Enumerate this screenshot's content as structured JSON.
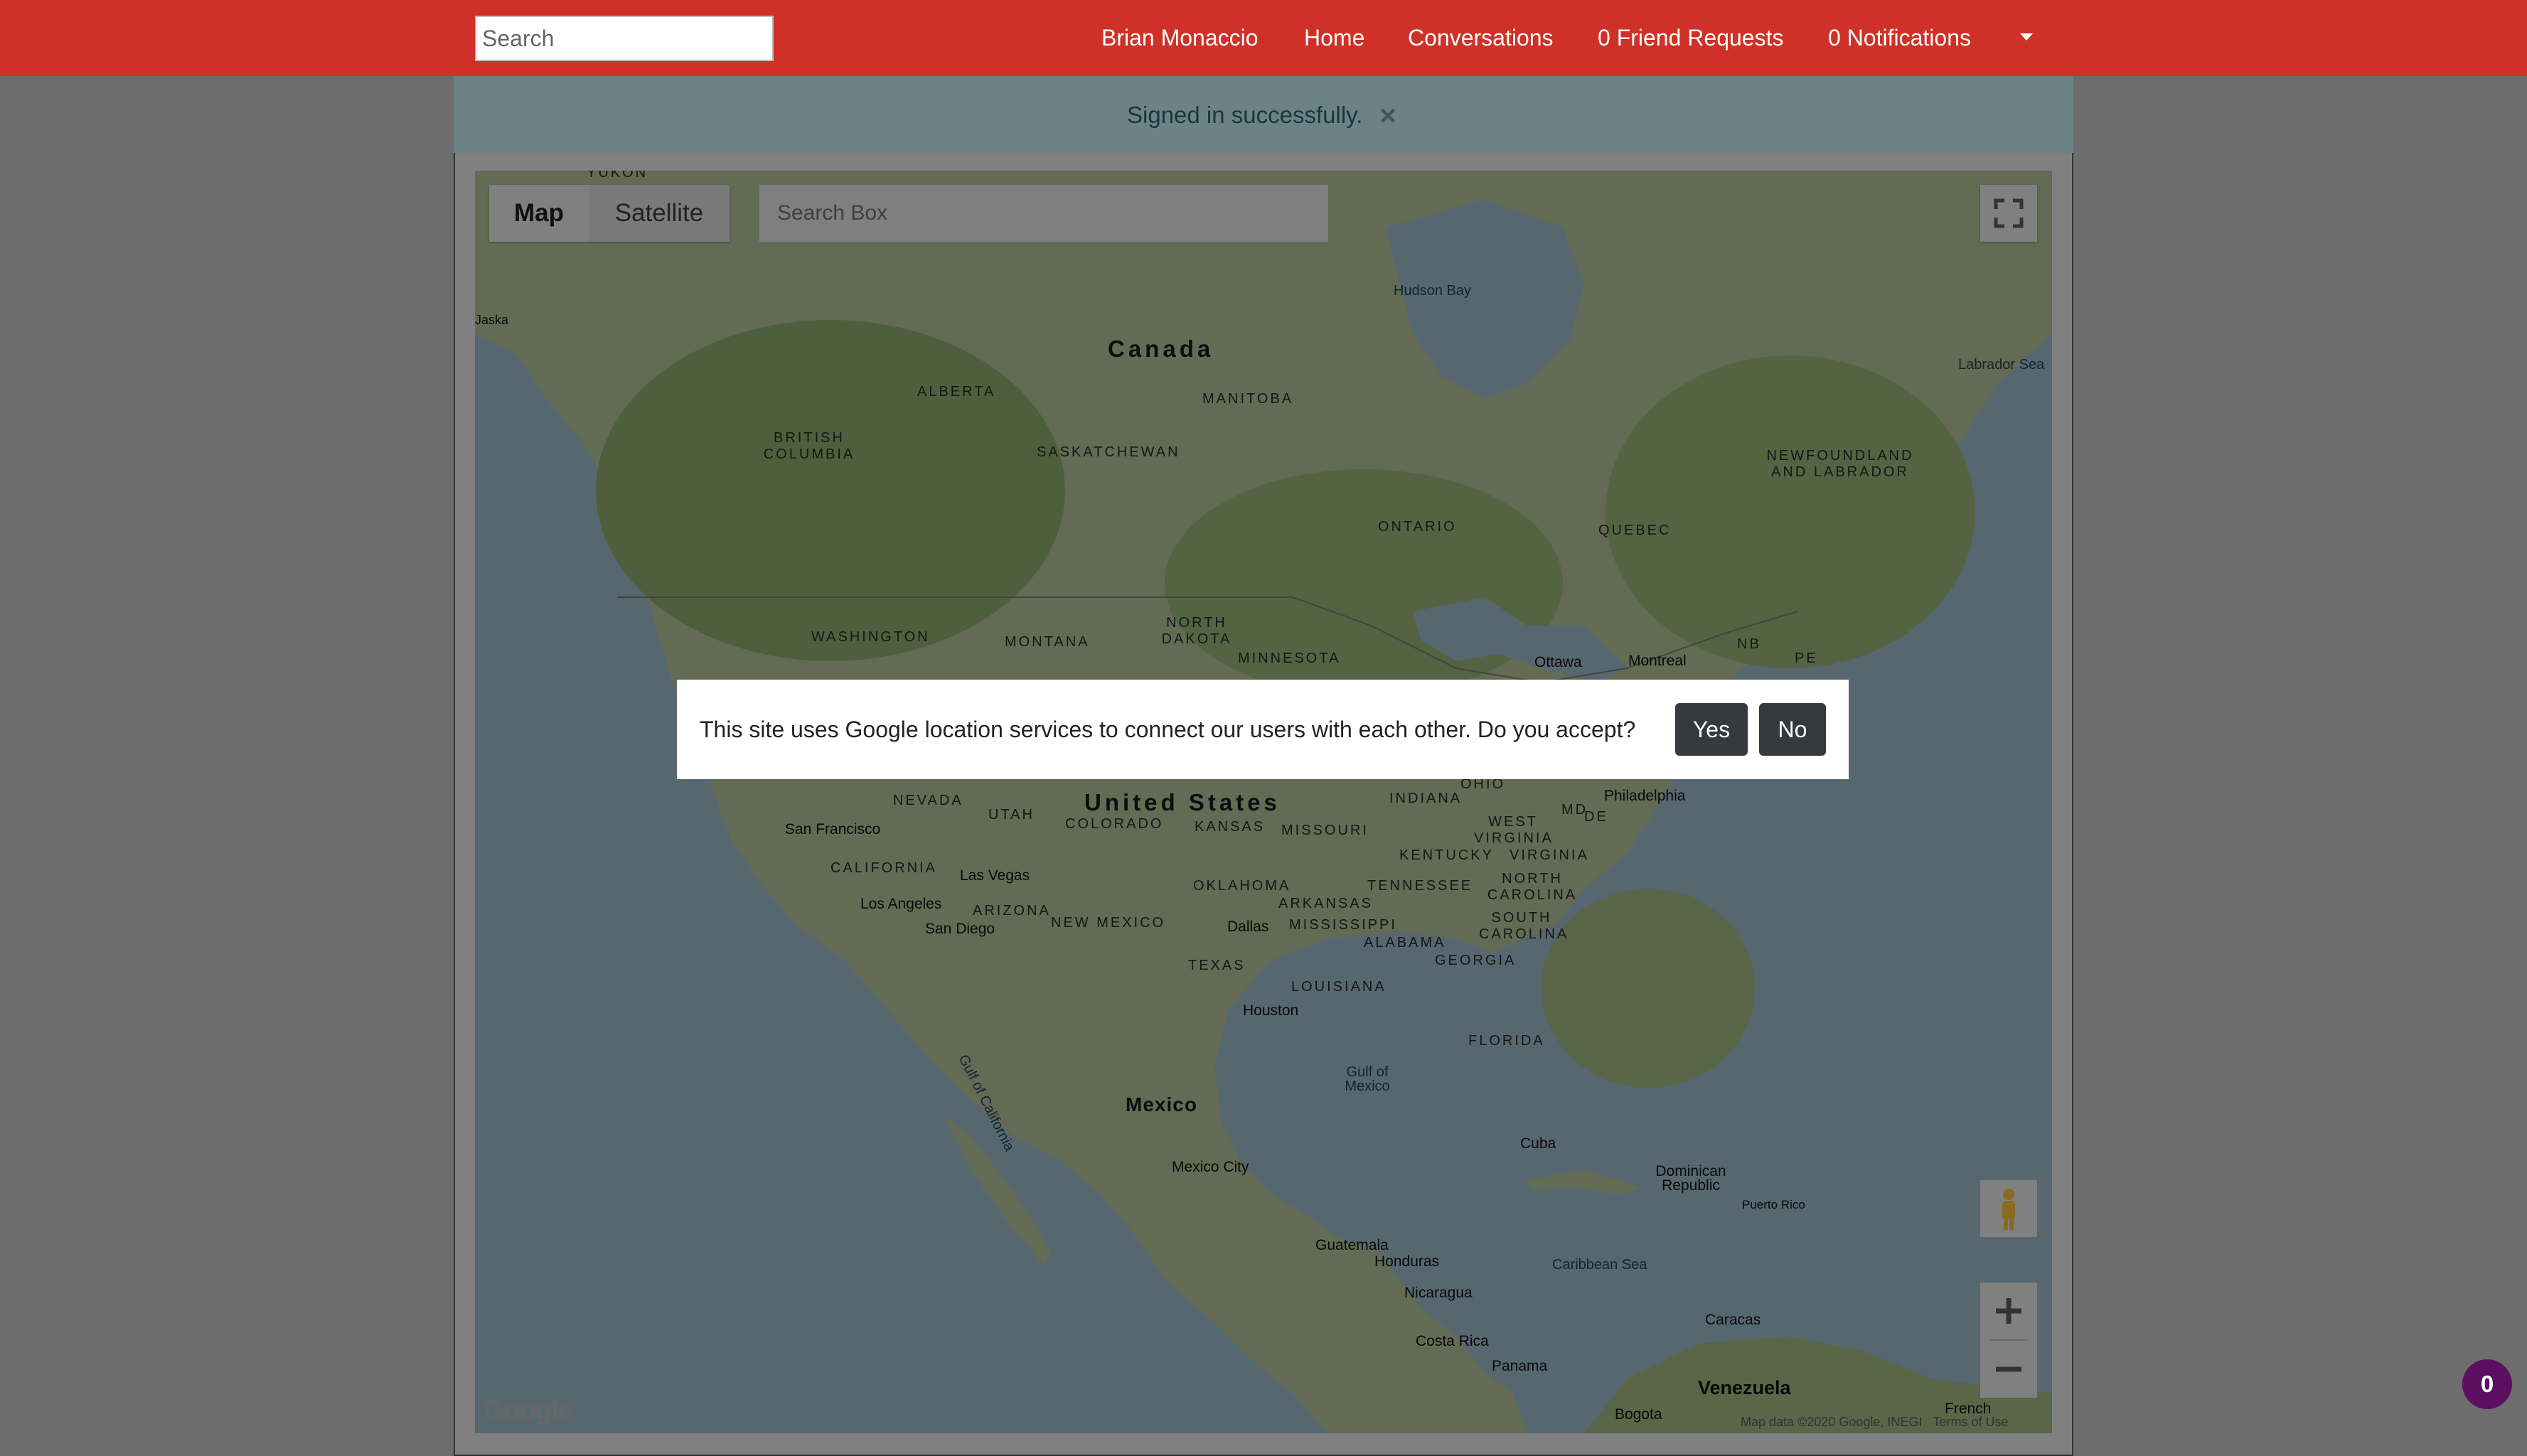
{
  "navbar": {
    "search_placeholder": "Search",
    "links": [
      "Brian Monaccio",
      "Home",
      "Conversations",
      "0 Friend Requests",
      "0 Notifications"
    ]
  },
  "flash": {
    "message": "Signed in successfully.",
    "close_glyph": "×"
  },
  "map": {
    "type_buttons": [
      "Map",
      "Satellite"
    ],
    "active_type": "Map",
    "search_placeholder": "Search Box",
    "countries": [
      "Canada",
      "United States",
      "Mexico"
    ],
    "regions": [
      "ALBERTA",
      "MANITOBA",
      "BRITISH COLUMBIA",
      "SASKATCHEWAN",
      "ONTARIO",
      "QUEBEC",
      "NEWFOUNDLAND AND LABRADOR",
      "WASHINGTON",
      "MONTANA",
      "NORTH DAKOTA",
      "MINNESOTA",
      "NEVADA",
      "UTAH",
      "COLORADO",
      "KANSAS",
      "MISSOURI",
      "INDIANA",
      "OHIO",
      "WEST VIRGINIA",
      "VIRGINIA",
      "KENTUCKY",
      "NORTH CAROLINA",
      "SOUTH CAROLINA",
      "TENNESSEE",
      "ARKANSAS",
      "MISSISSIPPI",
      "ALABAMA",
      "GEORGIA",
      "OKLAHOMA",
      "TEXAS",
      "LOUISIANA",
      "FLORIDA",
      "CALIFORNIA",
      "ARIZONA",
      "NEW MEXICO",
      "NB",
      "PE",
      "MD",
      "DE"
    ],
    "cities": [
      "Ottawa",
      "Montreal",
      "Philadelphia",
      "San Francisco",
      "Las Vegas",
      "Los Angeles",
      "San Diego",
      "Dallas",
      "Houston",
      "Mexico City",
      "Cuba",
      "Dominican Republic",
      "Puerto Rico",
      "Guatemala",
      "Honduras",
      "Nicaragua",
      "Costa Rica",
      "Panama",
      "Caracas",
      "Venezuela",
      "Bogota",
      "French"
    ],
    "seas": [
      "Hudson Bay",
      "Labrador Sea",
      "Gulf of Mexico",
      "Caribbean Sea",
      "Gulf of California"
    ],
    "edge_labels": [
      "Jaska",
      "YUKON"
    ],
    "logo": "Google",
    "attribution": "Map data ©2020 Google, INEGI",
    "terms": "Terms of Use",
    "fullscreen_icon": "fullscreen-icon",
    "pegman_icon": "pegman-icon",
    "zoom_in_icon": "plus-icon",
    "zoom_out_icon": "minus-icon",
    "colors": {
      "water": "#aecfe0",
      "land": "#c7d7a8",
      "forest": "#9dbf7a",
      "overlay": "rgba(0,0,0,0.5)"
    }
  },
  "consent": {
    "message": "This site uses Google location services to connect our users with each other. Do you accept?",
    "yes_label": "Yes",
    "no_label": "No"
  },
  "badge": {
    "count": "0"
  },
  "colors": {
    "navbar": "#cf3027",
    "flash_bg": "#d1ecf1",
    "button_dark": "#343a40",
    "badge": "#5b0f60"
  }
}
